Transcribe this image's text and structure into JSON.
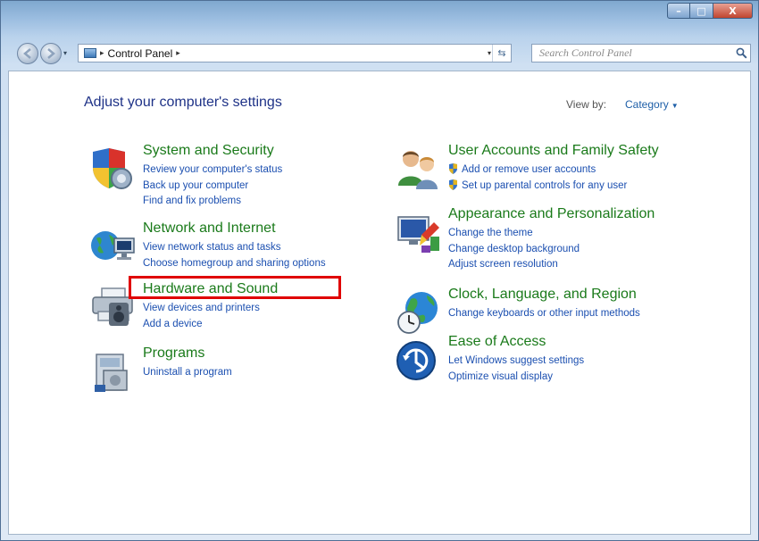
{
  "window": {
    "controls": {
      "minimize": "–",
      "maximize": "□",
      "close": "X"
    }
  },
  "navbar": {
    "back_icon": "back-arrow-icon",
    "forward_icon": "forward-arrow-icon",
    "recent_icon": "▾",
    "address": {
      "crumb": "Control Panel",
      "separator": "▸",
      "dropdown": "▾",
      "refresh": "⇆"
    },
    "search": {
      "placeholder": "Search Control Panel"
    }
  },
  "content": {
    "heading": "Adjust your computer's settings",
    "view_by": {
      "label": "View by:",
      "value": "Category",
      "arrow": "▼"
    },
    "categories_left": [
      {
        "title": "System and Security",
        "icon": "system-security-icon",
        "links": [
          "Review your computer's status",
          "Back up your computer",
          "Find and fix problems"
        ]
      },
      {
        "title": "Network and Internet",
        "icon": "network-internet-icon",
        "links": [
          "View network status and tasks",
          "Choose homegroup and sharing options"
        ]
      },
      {
        "title": "Hardware and Sound",
        "icon": "hardware-sound-icon",
        "links": [
          "View devices and printers",
          "Add a device"
        ]
      },
      {
        "title": "Programs",
        "icon": "programs-icon",
        "links": [
          "Uninstall a program"
        ]
      }
    ],
    "categories_right": [
      {
        "title": "User Accounts and Family Safety",
        "icon": "user-accounts-icon",
        "links": [
          "Add or remove user accounts",
          "Set up parental controls for any user"
        ]
      },
      {
        "title": "Appearance and Personalization",
        "icon": "appearance-icon",
        "links": [
          "Change the theme",
          "Change desktop background",
          "Adjust screen resolution"
        ]
      },
      {
        "title": "Clock, Language, and Region",
        "icon": "clock-globe-icon",
        "links": [
          "Change keyboards or other input methods"
        ]
      },
      {
        "title": "Ease of Access",
        "icon": "ease-of-access-icon",
        "links": [
          "Let Windows suggest settings",
          "Optimize visual display"
        ]
      }
    ]
  },
  "colors": {
    "title_green": "#1a7a1a",
    "link_blue": "#1b4fb0",
    "heading_blue": "#1e3287",
    "highlight_red": "#e00000"
  }
}
